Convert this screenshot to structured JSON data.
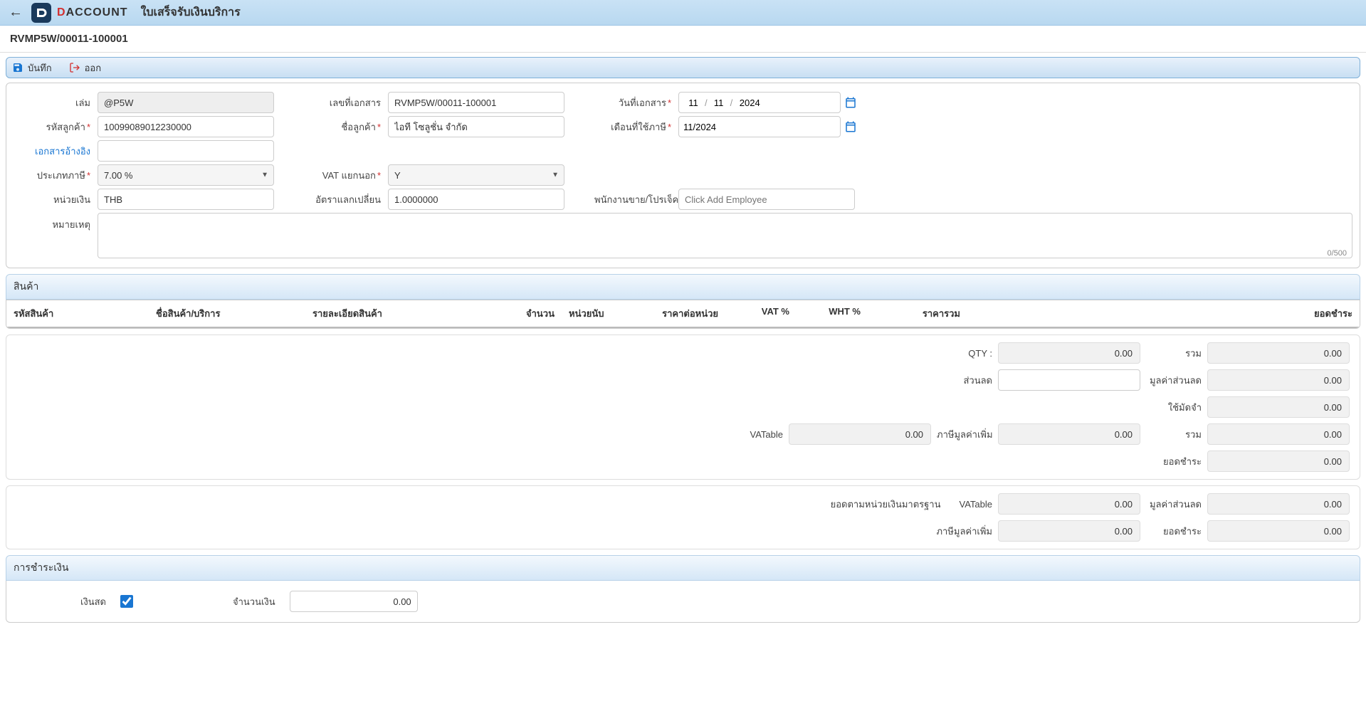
{
  "header": {
    "page_title": "ใบเสร็จรับเงินบริการ",
    "document_no": "RVMP5W/00011-100001",
    "logo_text_d": "D",
    "logo_text_account": "ACCOUNT"
  },
  "toolbar": {
    "save": "บันทึก",
    "exit": "ออก"
  },
  "form": {
    "book_label": "เล่ม",
    "book_value": "@P5W",
    "doc_no_label": "เลขที่เอกสาร",
    "doc_no_value": "RVMP5W/00011-100001",
    "doc_date_label": "วันที่เอกสาร",
    "doc_date_day": "11",
    "doc_date_month": "11",
    "doc_date_year": "2024",
    "customer_code_label": "รหัสลูกค้า",
    "customer_code_value": "10099089012230000",
    "customer_name_label": "ชื่อลูกค้า",
    "customer_name_value": "ไอที โซลูชั่น จำกัด",
    "tax_month_label": "เดือนที่ใช้ภาษี",
    "tax_month_value": "11/2024",
    "ref_doc_label": "เอกสารอ้างอิง",
    "ref_doc_value": "",
    "tax_type_label": "ประเภทภาษี",
    "tax_type_value": "7.00 %",
    "vat_separate_label": "VAT แยกนอก",
    "vat_separate_value": "Y",
    "currency_label": "หน่วยเงิน",
    "currency_value": "THB",
    "exchange_rate_label": "อัตราแลกเปลี่ยน",
    "exchange_rate_value": "1.0000000",
    "employee_label": "พนักงานขาย/โปรเจ็ค",
    "employee_placeholder": "Click Add Employee",
    "remark_label": "หมายเหตุ",
    "remark_value": "",
    "char_count": "0/500"
  },
  "products": {
    "section_title": "สินค้า",
    "columns": {
      "code": "รหัสสินค้า",
      "name": "ชื่อสินค้า/บริการ",
      "detail": "รายละเอียดสินค้า",
      "qty": "จำนวน",
      "unit": "หน่วยนับ",
      "unit_price": "ราคาต่อหน่วย",
      "vat_pct": "VAT %",
      "wht_pct": "WHT %",
      "total": "ราคารวม",
      "balance": "ยอดชำระ"
    }
  },
  "summary1": {
    "qty_label": "QTY :",
    "qty_value": "0.00",
    "sum_label": "รวม",
    "sum_value": "0.00",
    "discount_label": "ส่วนลด",
    "discount_value": "",
    "discount_amount_label": "มูลค่าส่วนลด",
    "discount_amount_value": "0.00",
    "deposit_label": "ใช้มัดจำ",
    "deposit_value": "0.00",
    "vatable_label": "VATable",
    "vatable_value": "0.00",
    "vat_label": "ภาษีมูลค่าเพิ่ม",
    "vat_value": "0.00",
    "total_label": "รวม",
    "total_value": "0.00",
    "balance_label": "ยอดชำระ",
    "balance_value": "0.00"
  },
  "summary2": {
    "std_currency_label": "ยอดตามหน่วยเงินมาตรฐาน",
    "vatable_label": "VATable",
    "vatable_value": "0.00",
    "discount_amount_label": "มูลค่าส่วนลด",
    "discount_amount_value": "0.00",
    "vat_label": "ภาษีมูลค่าเพิ่ม",
    "vat_value": "0.00",
    "balance_label": "ยอดชำระ",
    "balance_value": "0.00"
  },
  "payment": {
    "section_title": "การชำระเงิน",
    "cash_label": "เงินสด",
    "cash_checked": true,
    "amount_label": "จำนวนเงิน",
    "amount_value": "0.00"
  }
}
